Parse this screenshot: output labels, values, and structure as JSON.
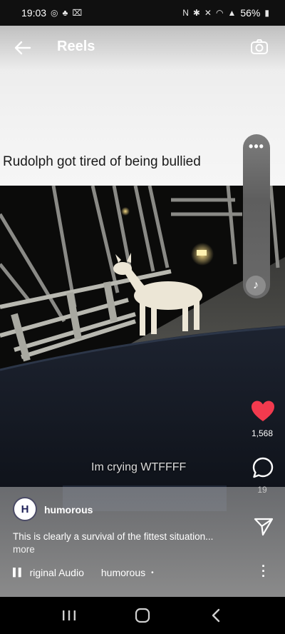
{
  "status_bar": {
    "time": "19:03",
    "battery": "56%",
    "left_icons": [
      "instagram-icon",
      "snapchat-icon",
      "screenshot-icon"
    ],
    "right_icons": [
      "nfc-icon",
      "bluetooth-icon",
      "mute-icon",
      "wifi-icon",
      "signal-icon",
      "battery-icon"
    ]
  },
  "header": {
    "title": "Reels",
    "back_icon": "arrow-left-icon",
    "camera_icon": "camera-icon"
  },
  "post": {
    "overlay_caption": "Rudolph got tired of being bullied",
    "video_subtitle": "Im crying WTFFFF",
    "likes": "1,568",
    "comments": "19",
    "username": "humorous",
    "avatar_letter": "H",
    "caption": "This is clearly a survival of the fittest situation...",
    "more": "more",
    "audio": "riginal Audio",
    "audio_author": "humorous",
    "audio_dot": "•"
  },
  "colors": {
    "like": "#f23a4e",
    "status_bg": "#101010",
    "nav_bg": "#000000"
  },
  "nav": {
    "recents_icon": "recents-icon",
    "home_icon": "home-icon",
    "back_icon": "back-icon"
  }
}
